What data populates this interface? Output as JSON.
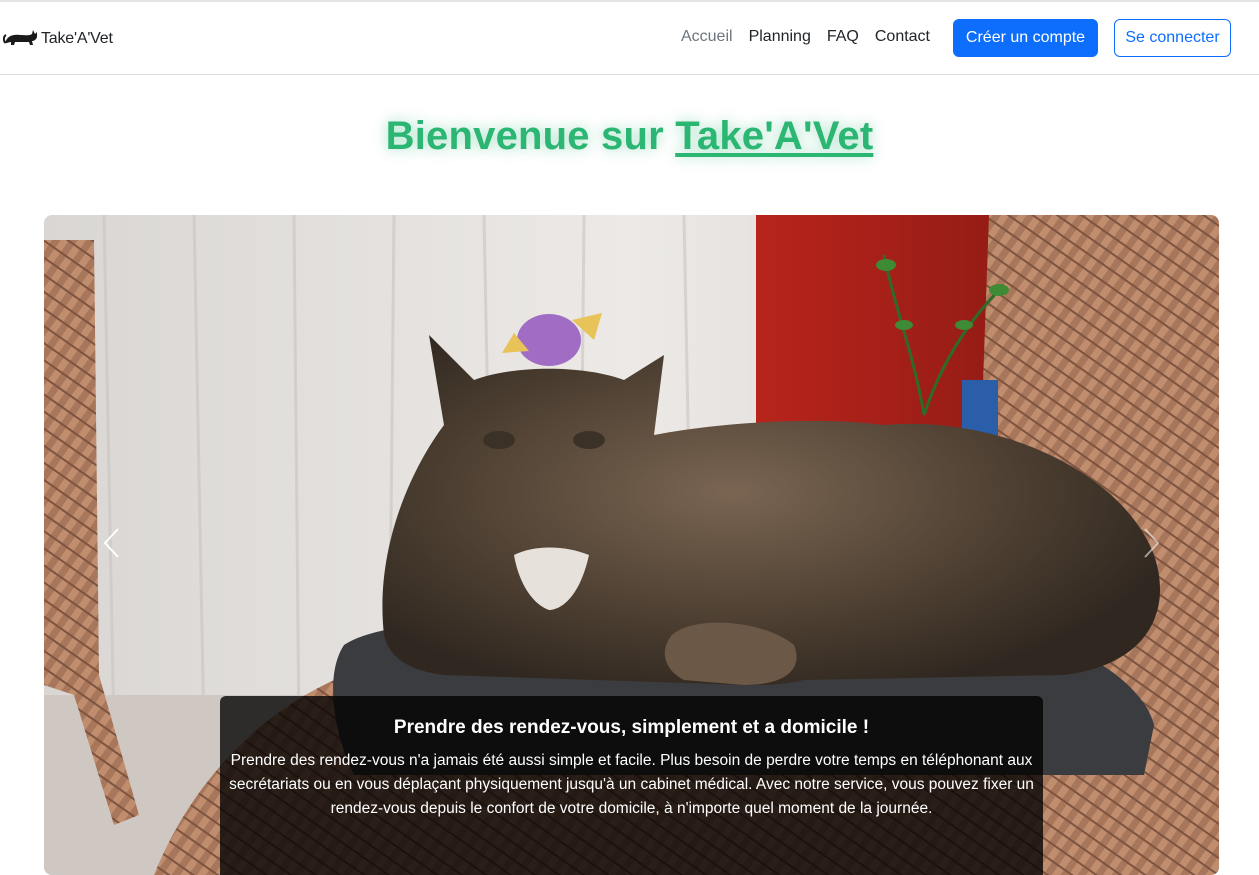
{
  "brand": {
    "name": "Take'A'Vet",
    "logo_icon": "cat-icon"
  },
  "nav": {
    "items": [
      {
        "label": "Accueil",
        "active": true
      },
      {
        "label": "Planning"
      },
      {
        "label": "FAQ"
      },
      {
        "label": "Contact"
      }
    ],
    "register_label": "Créer un compte",
    "login_label": "Se connecter"
  },
  "hero": {
    "title_prefix": "Bienvenue sur ",
    "title_link": "Take'A'Vet"
  },
  "carousel": {
    "prev_icon": "chevron-left-icon",
    "next_icon": "chevron-right-icon",
    "slide": {
      "caption_title": "Prendre des rendez-vous, simplement et a domicile !",
      "caption_text": "Prendre des rendez-vous n'a jamais été aussi simple et facile. Plus besoin de perdre votre temps en téléphonant aux secrétariats ou en vous déplaçant physiquement jusqu'à un cabinet médical. Avec notre service, vous pouvez fixer un rendez-vous depuis le confort de votre domicile, à n'importe quel moment de la journée."
    }
  },
  "colors": {
    "primary": "#0d6efd",
    "accent_green": "#2bb673"
  }
}
